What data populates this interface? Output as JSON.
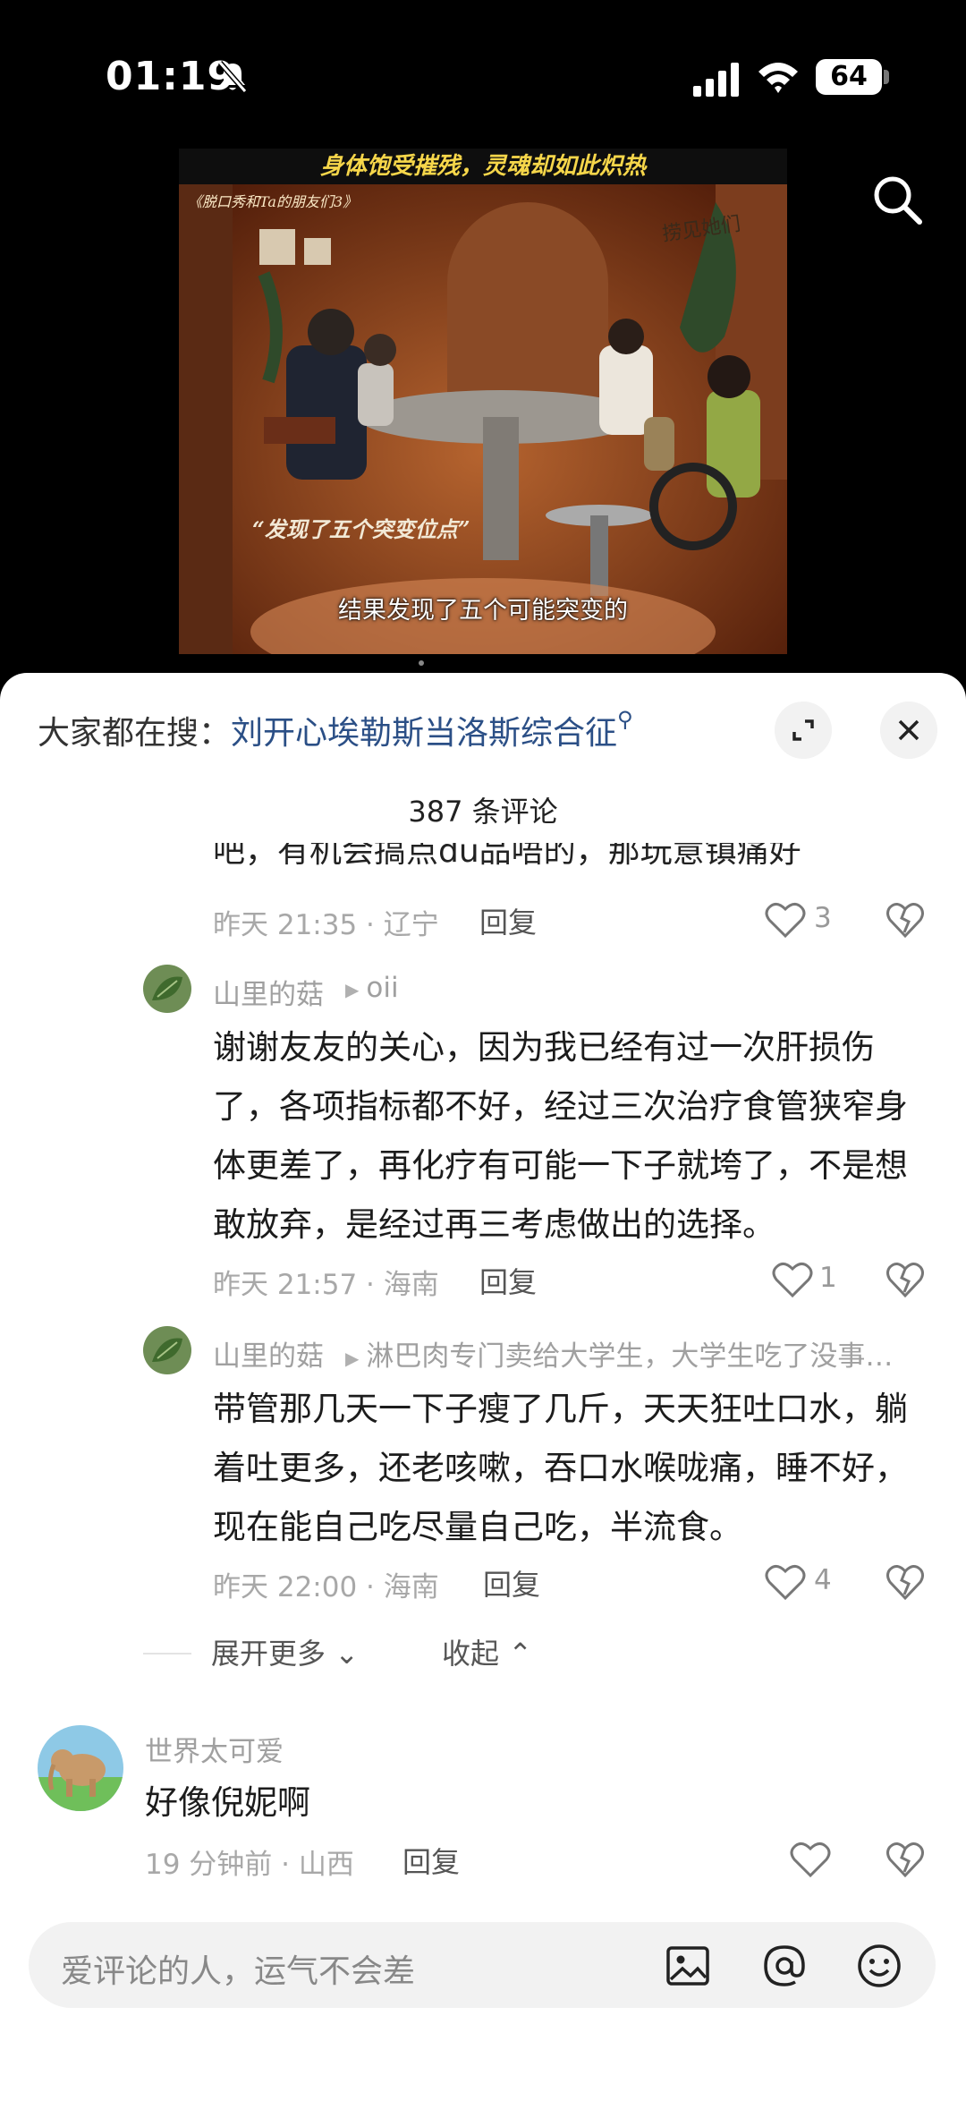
{
  "status_bar": {
    "time": "01:19",
    "battery": "64"
  },
  "video": {
    "banner": "身体饱受摧残，灵魂却如此炽热",
    "show_title": "《脱口秀和Ta的朋友们3》",
    "logo_text": "捞见她们",
    "quote": "“发现了五个突变位点”",
    "subtitle": "结果发现了五个可能突变的"
  },
  "sheet": {
    "hot_search_label": "大家都在搜：",
    "hot_search_term": "刘开心埃勒斯当洛斯综合征",
    "comment_count": "387 条评论",
    "clipped_text": "吧，有机会搞点du品唔的，那玩意镇痛好",
    "comments": [
      {
        "time_location": "昨天 21:35 · 辽宁",
        "reply_label": "回复",
        "likes": "3"
      },
      {
        "user": "山里的菇",
        "reply_to": "oii",
        "text": "谢谢友友的关心，因为我已经有过一次肝损伤了，各项指标都不好，经过三次治疗食管狭窄身体更差了，再化疗有可能一下子就垮了，不是想敢放弃，是经过再三考虑做出的选择。",
        "time_location": "昨天 21:57 · 海南",
        "reply_label": "回复",
        "likes": "1"
      },
      {
        "user": "山里的菇",
        "reply_to": "淋巴肉专门卖给大学生，大学生吃了没事，我们吃了就...",
        "text": "带管那几天一下子瘦了几斤，天天狂吐口水，躺着吐更多，还老咳嗽，吞口水喉咙痛，睡不好，现在能自己吃尽量自己吃，半流食。",
        "time_location": "昨天 22:00 · 海南",
        "reply_label": "回复",
        "likes": "4"
      },
      {
        "user": "世界太可爱",
        "text": "好像倪妮啊",
        "time_location": "19 分钟前 · 山西",
        "reply_label": "回复",
        "likes": ""
      }
    ],
    "expand_more": "展开更多",
    "collapse": "收起"
  },
  "input": {
    "placeholder": "爱评论的人，运气不会差"
  },
  "icons": [
    "bell-slash-icon",
    "signal-icon",
    "wifi-icon",
    "search-icon",
    "expand-icon",
    "close-icon",
    "heart-icon",
    "dislike-icon",
    "image-icon",
    "at-icon",
    "emoji-icon"
  ]
}
